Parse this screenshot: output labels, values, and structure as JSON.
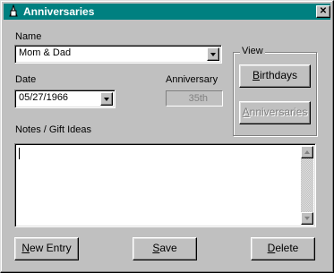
{
  "window": {
    "title": "Anniversaries",
    "close_label": "✕"
  },
  "form": {
    "name_label": "Name",
    "name_value": "Mom & Dad",
    "date_label": "Date",
    "date_value": "05/27/1966",
    "anniversary_label": "Anniversary",
    "anniversary_value": "35th",
    "notes_label": "Notes / Gift Ideas",
    "notes_value": ""
  },
  "view": {
    "caption": "View",
    "birthdays_mnemonic": "B",
    "birthdays_rest": "irthdays",
    "anniversaries_mnemonic": "A",
    "anniversaries_rest": "nniversaries"
  },
  "buttons": {
    "new_mnemonic": "N",
    "new_rest": "ew Entry",
    "save_mnemonic": "S",
    "save_rest": "ave",
    "delete_mnemonic": "D",
    "delete_rest": "elete"
  },
  "colors": {
    "titlebar": "#008080",
    "face": "#c0c0c0"
  }
}
